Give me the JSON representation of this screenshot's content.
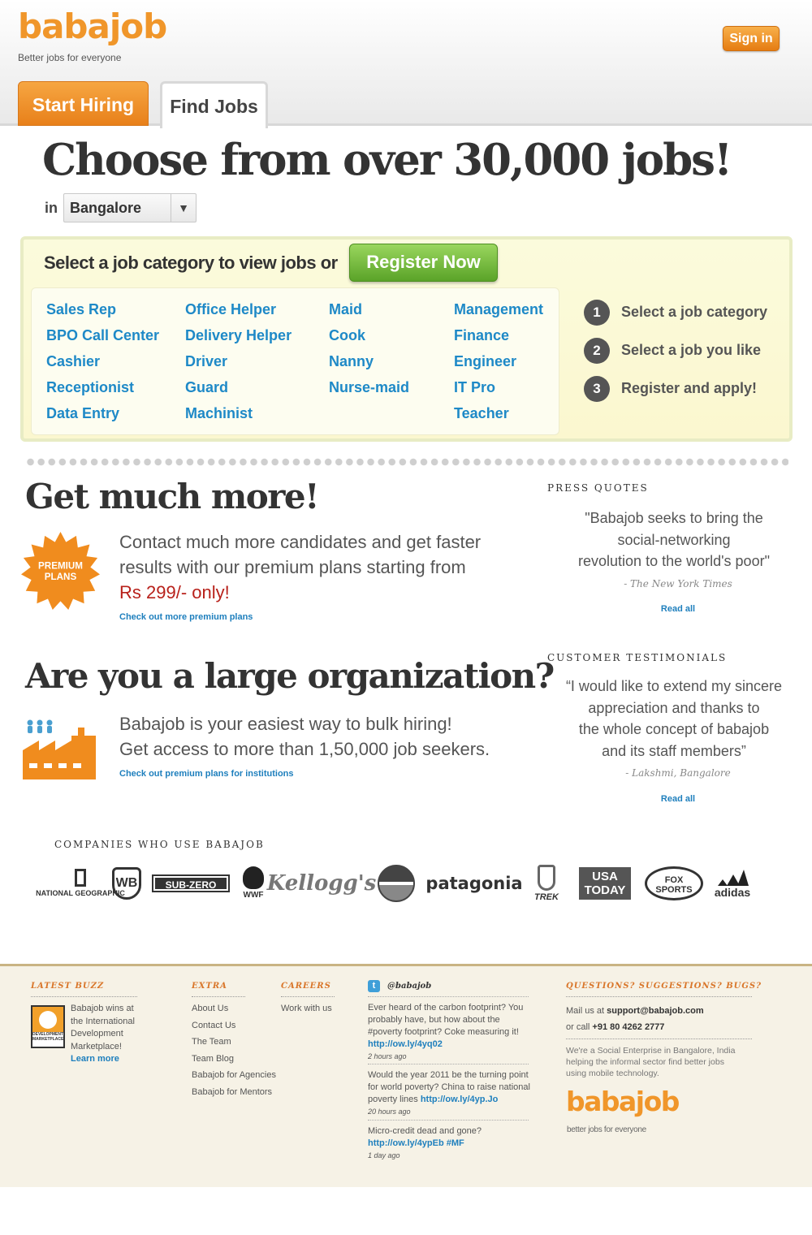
{
  "header": {
    "logo": "babajob",
    "tagline": "Better jobs for everyone",
    "signin_label": "Sign in",
    "tabs": [
      {
        "label": "Start Hiring"
      },
      {
        "label": "Find Jobs"
      }
    ]
  },
  "hero": {
    "headline": "Choose from over 30,000 jobs!",
    "in_label": "in",
    "city": "Bangalore"
  },
  "categories": {
    "title": "Select a job category to view jobs or",
    "register_label": "Register Now",
    "columns": [
      [
        "Sales Rep",
        "BPO Call Center",
        "Cashier",
        "Receptionist",
        "Data Entry"
      ],
      [
        "Office Helper",
        "Delivery Helper",
        "Driver",
        "Guard",
        "Machinist"
      ],
      [
        "Maid",
        "Cook",
        "Nanny",
        "Nurse-maid"
      ],
      [
        "Management",
        "Finance",
        "Engineer",
        "IT Pro",
        "Teacher"
      ]
    ],
    "steps": [
      {
        "num": "1",
        "text": "Select a job category"
      },
      {
        "num": "2",
        "text": "Select a job you like"
      },
      {
        "num": "3",
        "text": "Register and apply!"
      }
    ]
  },
  "more": {
    "title": "Get much more!",
    "badge_line1": "PREMIUM",
    "badge_line2": "PLANS",
    "line1": "Contact much more candidates and get faster",
    "line2": "results with our premium plans starting from",
    "price": "Rs 299/- only!",
    "link": "Check out more premium plans"
  },
  "org": {
    "title": "Are you a large organization?",
    "line1": "Babajob is your easiest way to bulk hiring!",
    "line2": "Get access to more than 1,50,000 job seekers.",
    "link": "Check out premium plans for institutions"
  },
  "press": {
    "label": "PRESS QUOTES",
    "quote_lines": [
      "\"Babajob seeks to bring the",
      "social-networking",
      "revolution to the world's poor\""
    ],
    "source": "- The New York Times",
    "read_all": "Read all"
  },
  "testimonials": {
    "label": "CUSTOMER  TESTIMONIALS",
    "quote_lines": [
      "“I would like to extend my sincere",
      "appreciation and thanks to",
      "the whole concept of babajob",
      "and its staff members”"
    ],
    "source": "- Lakshmi, Bangalore",
    "read_all": "Read all"
  },
  "companies": {
    "label": "COMPANIES WHO USE BABAJOB",
    "logos": [
      "NATIONAL GEOGRAPHIC",
      "WB",
      "SUB-ZERO",
      "WWF",
      "Kellogg's",
      "Obama",
      "patagonia",
      "TREK",
      "USA TODAY",
      "FOX SPORTS",
      "adidas"
    ]
  },
  "footer": {
    "buzz": {
      "heading": "LATEST BUZZ",
      "text_lines": [
        "Babajob wins at",
        "the International",
        "Development",
        "Marketplace!"
      ],
      "link": "Learn more",
      "image_text": "DEVELOPMENT MARKETPLACE"
    },
    "extra": {
      "heading": "EXTRA",
      "links": [
        "About Us",
        "Contact Us",
        "The Team",
        "Team Blog",
        "Babajob for Agencies",
        "Babajob for Mentors"
      ]
    },
    "careers": {
      "heading": "CAREERS",
      "links": [
        "Work with us"
      ]
    },
    "twitter": {
      "handle": "@babajob",
      "tweets": [
        {
          "text": "Ever heard of the carbon footprint? You probably have, but how about the #poverty footprint? Coke measuring it!",
          "link": "http://ow.ly/4yq02",
          "ago": "2 hours ago"
        },
        {
          "text": "Would the year 2011 be the turning point for world poverty? China to raise national poverty lines",
          "link": "http://ow.ly/4yp.Jo",
          "ago": "20 hours ago"
        },
        {
          "text": "Micro-credit dead and gone?",
          "link": "http://ow.ly/4ypEb #MF",
          "ago": "1 day ago"
        }
      ]
    },
    "contact": {
      "heading": "QUESTIONS? SUGGESTIONS? BUGS?",
      "mail_prefix": "Mail us at",
      "mail": "support@babajob.com",
      "call_prefix": "or call",
      "phone": "+91 80 4262 2777",
      "about": "We're a Social Enterprise in Bangalore, India helping the informal sector find better jobs using mobile technology.",
      "logo": "babajob",
      "logo_tagline": "better jobs for everyone"
    }
  },
  "colors": {
    "orange": "#f0962a",
    "link_blue": "#1e89c7",
    "green": "#6bb33b",
    "price_red": "#b8211b"
  }
}
